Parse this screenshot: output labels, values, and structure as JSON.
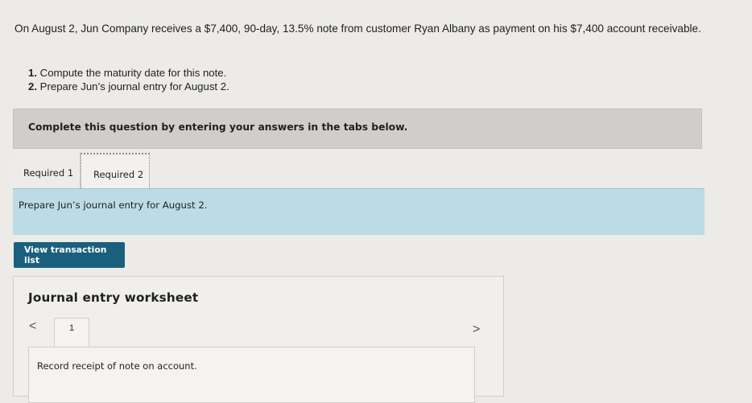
{
  "problem": {
    "text": "On August 2, Jun Company receives a $7,400, 90-day, 13.5% note from customer Ryan Albany as payment on his $7,400 account receivable.",
    "tasks": [
      {
        "num": "1.",
        "text": "Compute the maturity date for this note."
      },
      {
        "num": "2.",
        "text": "Prepare Jun’s journal entry for August 2."
      }
    ]
  },
  "banner": {
    "text": "Complete this question by entering your answers in the tabs below."
  },
  "tabs": [
    {
      "label": "Required 1"
    },
    {
      "label": "Required 2"
    }
  ],
  "instruction": {
    "text": "Prepare Jun’s journal entry for August 2."
  },
  "view_button": {
    "label": "View transaction list"
  },
  "worksheet": {
    "title": "Journal entry worksheet",
    "prev_icon": "<",
    "next_icon": ">",
    "page": "1",
    "entry_description": "Record receipt of note on account."
  }
}
